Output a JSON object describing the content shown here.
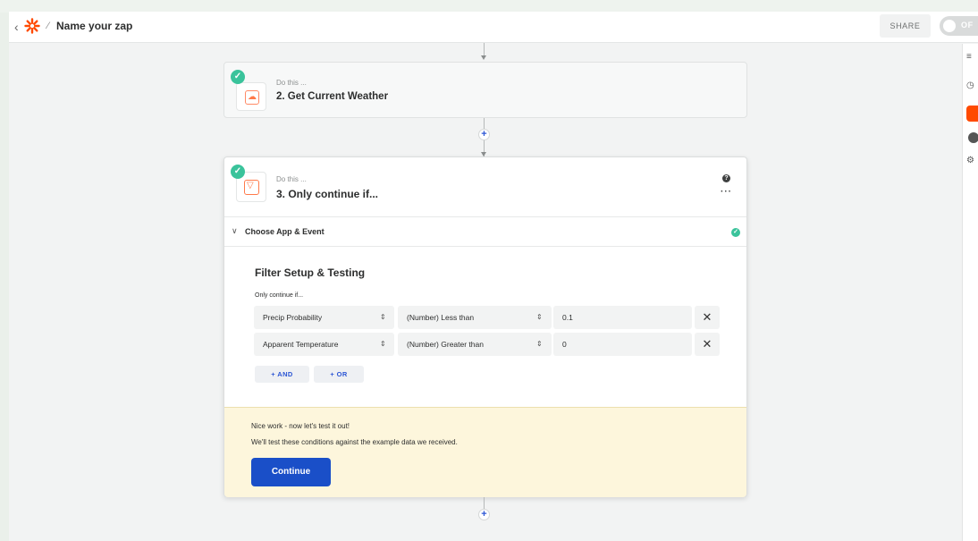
{
  "header": {
    "zap_name": "Name your zap",
    "share_label": "SHARE",
    "toggle_label": "OF"
  },
  "steps": [
    {
      "kicker": "Do this ...",
      "title": "2. Get Current Weather",
      "icon": "cloud-icon"
    },
    {
      "kicker": "Do this ...",
      "title": "3. Only continue if...",
      "icon": "filter-icon"
    }
  ],
  "section": {
    "label": "Choose App & Event"
  },
  "filter": {
    "title": "Filter Setup & Testing",
    "subtitle": "Only continue if...",
    "rows": [
      {
        "field": "Precip Probability",
        "operator": "(Number) Less than",
        "value": "0.1"
      },
      {
        "field": "Apparent Temperature",
        "operator": "(Number) Greater than",
        "value": "0"
      }
    ],
    "and_label": "+ AND",
    "or_label": "+ OR"
  },
  "notice": {
    "line1": "Nice work - now let's test it out!",
    "line2": "We'll test these conditions against the example data we received.",
    "button": "Continue"
  },
  "colors": {
    "accent_blue": "#1a4fc8",
    "success_green": "#3ac39b",
    "brand_orange": "#ff4a00",
    "notice_bg": "#fdf6dc"
  }
}
